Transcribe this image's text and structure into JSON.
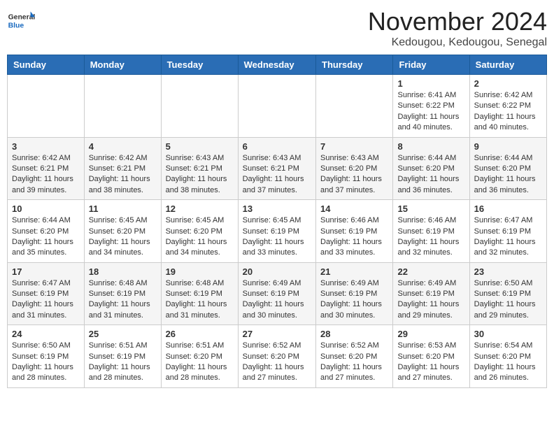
{
  "header": {
    "logo_general": "General",
    "logo_blue": "Blue",
    "month": "November 2024",
    "location": "Kedougou, Kedougou, Senegal"
  },
  "weekdays": [
    "Sunday",
    "Monday",
    "Tuesday",
    "Wednesday",
    "Thursday",
    "Friday",
    "Saturday"
  ],
  "weeks": [
    [
      {
        "day": "",
        "info": ""
      },
      {
        "day": "",
        "info": ""
      },
      {
        "day": "",
        "info": ""
      },
      {
        "day": "",
        "info": ""
      },
      {
        "day": "",
        "info": ""
      },
      {
        "day": "1",
        "info": "Sunrise: 6:41 AM\nSunset: 6:22 PM\nDaylight: 11 hours and 40 minutes."
      },
      {
        "day": "2",
        "info": "Sunrise: 6:42 AM\nSunset: 6:22 PM\nDaylight: 11 hours and 40 minutes."
      }
    ],
    [
      {
        "day": "3",
        "info": "Sunrise: 6:42 AM\nSunset: 6:21 PM\nDaylight: 11 hours and 39 minutes."
      },
      {
        "day": "4",
        "info": "Sunrise: 6:42 AM\nSunset: 6:21 PM\nDaylight: 11 hours and 38 minutes."
      },
      {
        "day": "5",
        "info": "Sunrise: 6:43 AM\nSunset: 6:21 PM\nDaylight: 11 hours and 38 minutes."
      },
      {
        "day": "6",
        "info": "Sunrise: 6:43 AM\nSunset: 6:21 PM\nDaylight: 11 hours and 37 minutes."
      },
      {
        "day": "7",
        "info": "Sunrise: 6:43 AM\nSunset: 6:20 PM\nDaylight: 11 hours and 37 minutes."
      },
      {
        "day": "8",
        "info": "Sunrise: 6:44 AM\nSunset: 6:20 PM\nDaylight: 11 hours and 36 minutes."
      },
      {
        "day": "9",
        "info": "Sunrise: 6:44 AM\nSunset: 6:20 PM\nDaylight: 11 hours and 36 minutes."
      }
    ],
    [
      {
        "day": "10",
        "info": "Sunrise: 6:44 AM\nSunset: 6:20 PM\nDaylight: 11 hours and 35 minutes."
      },
      {
        "day": "11",
        "info": "Sunrise: 6:45 AM\nSunset: 6:20 PM\nDaylight: 11 hours and 34 minutes."
      },
      {
        "day": "12",
        "info": "Sunrise: 6:45 AM\nSunset: 6:20 PM\nDaylight: 11 hours and 34 minutes."
      },
      {
        "day": "13",
        "info": "Sunrise: 6:45 AM\nSunset: 6:19 PM\nDaylight: 11 hours and 33 minutes."
      },
      {
        "day": "14",
        "info": "Sunrise: 6:46 AM\nSunset: 6:19 PM\nDaylight: 11 hours and 33 minutes."
      },
      {
        "day": "15",
        "info": "Sunrise: 6:46 AM\nSunset: 6:19 PM\nDaylight: 11 hours and 32 minutes."
      },
      {
        "day": "16",
        "info": "Sunrise: 6:47 AM\nSunset: 6:19 PM\nDaylight: 11 hours and 32 minutes."
      }
    ],
    [
      {
        "day": "17",
        "info": "Sunrise: 6:47 AM\nSunset: 6:19 PM\nDaylight: 11 hours and 31 minutes."
      },
      {
        "day": "18",
        "info": "Sunrise: 6:48 AM\nSunset: 6:19 PM\nDaylight: 11 hours and 31 minutes."
      },
      {
        "day": "19",
        "info": "Sunrise: 6:48 AM\nSunset: 6:19 PM\nDaylight: 11 hours and 31 minutes."
      },
      {
        "day": "20",
        "info": "Sunrise: 6:49 AM\nSunset: 6:19 PM\nDaylight: 11 hours and 30 minutes."
      },
      {
        "day": "21",
        "info": "Sunrise: 6:49 AM\nSunset: 6:19 PM\nDaylight: 11 hours and 30 minutes."
      },
      {
        "day": "22",
        "info": "Sunrise: 6:49 AM\nSunset: 6:19 PM\nDaylight: 11 hours and 29 minutes."
      },
      {
        "day": "23",
        "info": "Sunrise: 6:50 AM\nSunset: 6:19 PM\nDaylight: 11 hours and 29 minutes."
      }
    ],
    [
      {
        "day": "24",
        "info": "Sunrise: 6:50 AM\nSunset: 6:19 PM\nDaylight: 11 hours and 28 minutes."
      },
      {
        "day": "25",
        "info": "Sunrise: 6:51 AM\nSunset: 6:19 PM\nDaylight: 11 hours and 28 minutes."
      },
      {
        "day": "26",
        "info": "Sunrise: 6:51 AM\nSunset: 6:20 PM\nDaylight: 11 hours and 28 minutes."
      },
      {
        "day": "27",
        "info": "Sunrise: 6:52 AM\nSunset: 6:20 PM\nDaylight: 11 hours and 27 minutes."
      },
      {
        "day": "28",
        "info": "Sunrise: 6:52 AM\nSunset: 6:20 PM\nDaylight: 11 hours and 27 minutes."
      },
      {
        "day": "29",
        "info": "Sunrise: 6:53 AM\nSunset: 6:20 PM\nDaylight: 11 hours and 27 minutes."
      },
      {
        "day": "30",
        "info": "Sunrise: 6:54 AM\nSunset: 6:20 PM\nDaylight: 11 hours and 26 minutes."
      }
    ]
  ]
}
